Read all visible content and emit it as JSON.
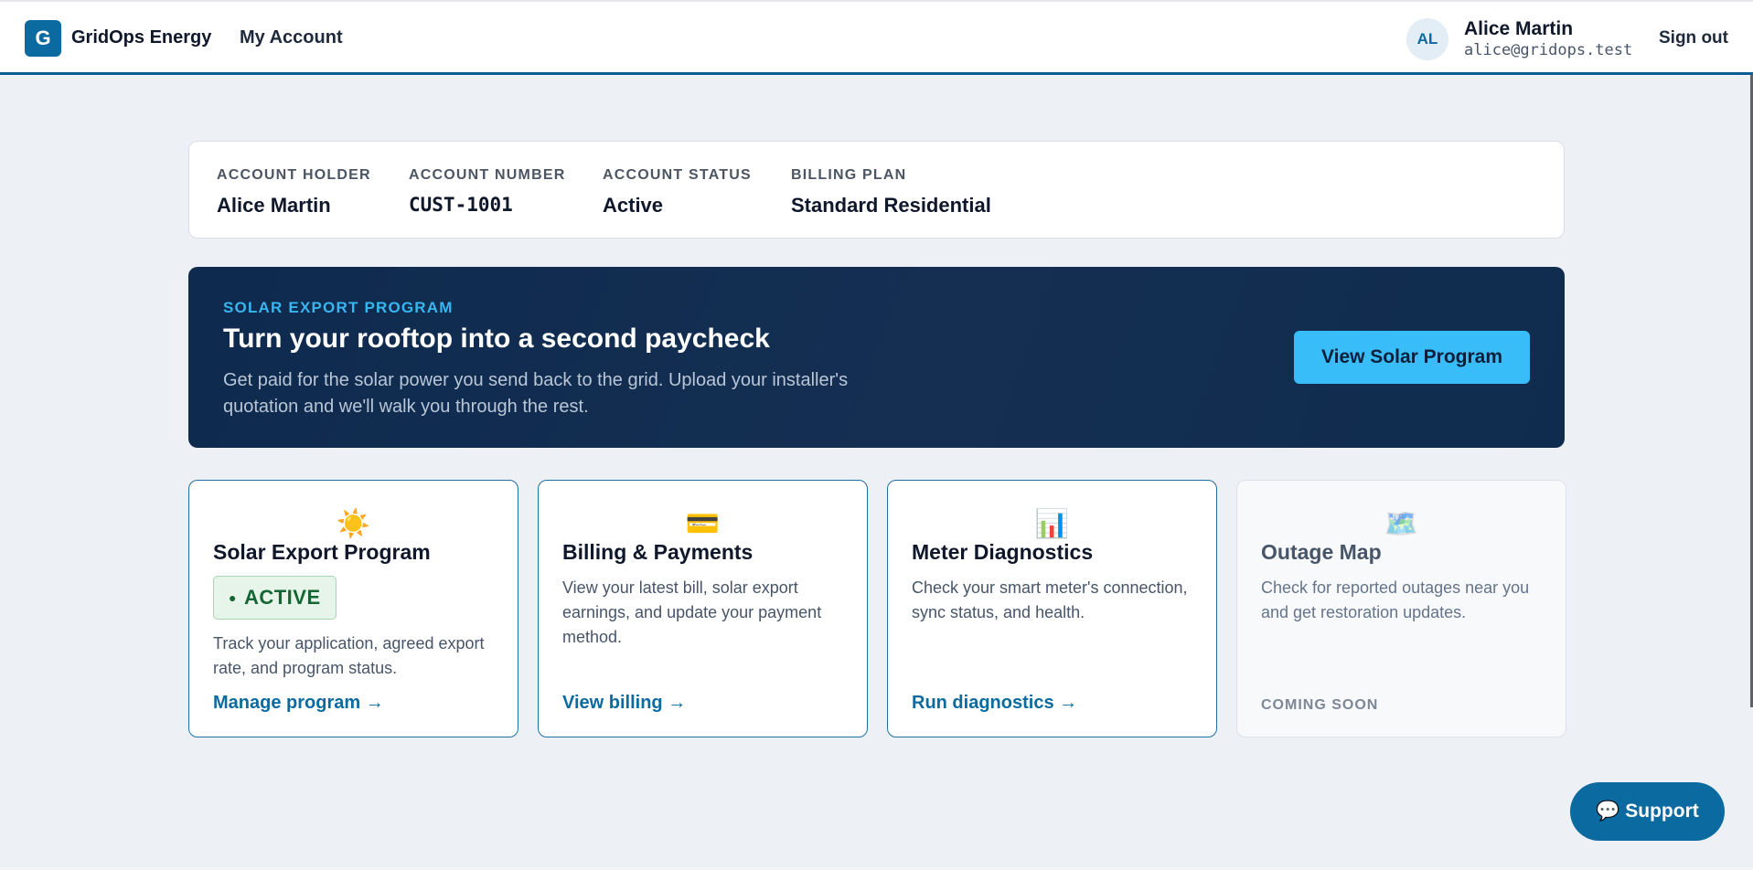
{
  "header": {
    "logo_letter": "G",
    "brand": "GridOps Energy",
    "nav_account": "My Account",
    "user_initials": "AL",
    "user_name": "Alice Martin",
    "user_email": "alice@gridops.test",
    "sign_out": "Sign out"
  },
  "account": {
    "fields": [
      {
        "label": "ACCOUNT HOLDER",
        "value": "Alice Martin"
      },
      {
        "label": "ACCOUNT NUMBER",
        "value": "CUST-1001"
      },
      {
        "label": "ACCOUNT STATUS",
        "value": "Active"
      },
      {
        "label": "BILLING PLAN",
        "value": "Standard Residential"
      }
    ]
  },
  "banner": {
    "eyebrow": "SOLAR EXPORT PROGRAM",
    "title": "Turn your rooftop into a second paycheck",
    "description": "Get paid for the solar power you send back to the grid. Upload your installer's quotation and we'll walk you through the rest.",
    "button": "View Solar Program"
  },
  "tiles": [
    {
      "icon": "☀️",
      "icon_name": "sun-icon",
      "title": "Solar Export Program",
      "badge": "ACTIVE",
      "badge_dot": "●",
      "description": "Track your application, agreed export rate, and program status.",
      "link": "Manage program →"
    },
    {
      "icon": "💳",
      "icon_name": "credit-card-icon",
      "title": "Billing & Payments",
      "description": "View your latest bill, solar export earnings, and update your payment method.",
      "link": "View billing →"
    },
    {
      "icon": "📊",
      "icon_name": "bar-chart-icon",
      "title": "Meter Diagnostics",
      "description": "Check your smart meter's connection, sync status, and health.",
      "link": "Run diagnostics →"
    },
    {
      "icon": "🗺️",
      "icon_name": "map-icon",
      "title": "Outage Map",
      "description": "Check for reported outages near you and get restoration updates.",
      "status": "COMING SOON"
    }
  ],
  "support": {
    "label": "💬 Support"
  }
}
